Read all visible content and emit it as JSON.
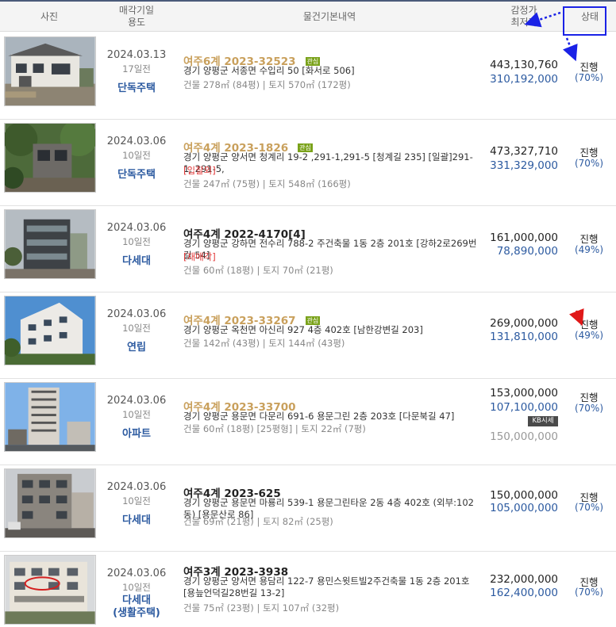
{
  "header": {
    "photo": "사진",
    "date_line1": "매각기일",
    "date_line2": "용도",
    "info": "물건기본내역",
    "price_line1": "감정가",
    "price_line2": "최저가",
    "status": "상태"
  },
  "rows": [
    {
      "date": "2024.03.13",
      "ago": "17일전",
      "usage": "단독주택",
      "usage2": "",
      "case": "여주6계 2023-32523",
      "badge": "관심",
      "addr": "경기 양평군 서종면 수입리 50 [화서로 506]",
      "note": "",
      "area": "건물 278㎡ (84평)  |  토지 570㎡ (172평)",
      "appraised": "443,130,760",
      "minimum": "310,192,000",
      "status": "진행",
      "percent": "(70%)"
    },
    {
      "date": "2024.03.06",
      "ago": "10일전",
      "usage": "단독주택",
      "usage2": "",
      "case": "여주4계 2023-1826",
      "badge": "관심",
      "addr": "경기 양평군 양서면 청계리 19-2 ,291-1,291-5 [청계길 235]  [일괄]291-1, 291-5,",
      "note": "[입찰외]",
      "area": "건물 247㎡ (75평)  |  토지 548㎡ (166평)",
      "appraised": "473,327,710",
      "minimum": "331,329,000",
      "status": "진행",
      "percent": "(70%)"
    },
    {
      "date": "2024.03.06",
      "ago": "10일전",
      "usage": "다세대",
      "usage2": "",
      "case": "여주4계 2022-4170[4]",
      "badge": "",
      "addr": "경기 양평군 강하면 전수리 788-2 주건축물 1동 2층 201호 [강하2로269번길 54]",
      "note": "[재매각]",
      "area": "건물 60㎡ (18평)  |  토지 70㎡ (21평)",
      "appraised": "161,000,000",
      "minimum": "78,890,000",
      "status": "진행",
      "percent": "(49%)"
    },
    {
      "date": "2024.03.06",
      "ago": "10일전",
      "usage": "연립",
      "usage2": "",
      "case": "여주4계 2023-33267",
      "badge": "관심",
      "addr": "경기 양평군 옥천면 아신리 927 4층 402호 [남한강변길 203]",
      "note": "",
      "area": "건물 142㎡ (43평)  |  토지 144㎡ (43평)",
      "appraised": "269,000,000",
      "minimum": "131,810,000",
      "status": "진행",
      "percent": "(49%)"
    },
    {
      "date": "2024.03.06",
      "ago": "10일전",
      "usage": "아파트",
      "usage2": "",
      "case": "여주4계 2023-33700",
      "badge": "",
      "addr": "경기 양평군 용문면 다문리 691-6 용문그린 2층 203호 [다문북길 47]",
      "note": "",
      "area": "건물 60㎡ (18평) [25평형]  |  토지 22㎡ (7평)",
      "appraised": "153,000,000",
      "minimum": "107,100,000",
      "sise_label": "KB시세",
      "sise_price": "150,000,000",
      "status": "진행",
      "percent": "(70%)"
    },
    {
      "date": "2024.03.06",
      "ago": "10일전",
      "usage": "다세대",
      "usage2": "",
      "case": "여주4계 2023-625",
      "badge": "",
      "addr": "경기 양평군 용문면 마룡리 539-1 용문그린타운 2동 4층 402호 (외부:102동) [용문산로 86]",
      "note": "",
      "area": "건물 69㎡ (21평)  |  토지 82㎡ (25평)",
      "appraised": "150,000,000",
      "minimum": "105,000,000",
      "status": "진행",
      "percent": "(70%)"
    },
    {
      "date": "2024.03.06",
      "ago": "10일전",
      "usage": "다세대",
      "usage2": "(생활주택)",
      "case": "여주3계 2023-3938",
      "badge": "",
      "addr": "경기 양평군 양서면 용담리 122-7 용민스윗트빌2주건축물 1동 2층 201호 [용늪언덕길28번길 13-2]",
      "note": "",
      "area": "건물 75㎡ (23평)  |  토지 107㎡ (32평)",
      "appraised": "232,000,000",
      "minimum": "162,400,000",
      "status": "진행",
      "percent": "(70%)"
    }
  ]
}
